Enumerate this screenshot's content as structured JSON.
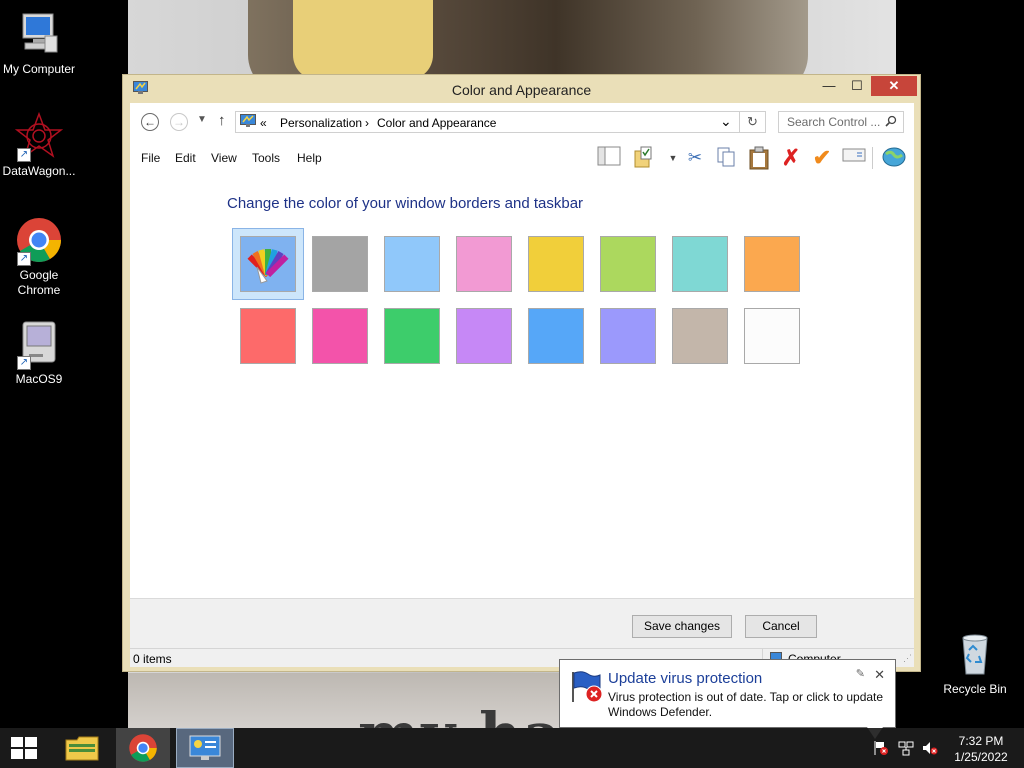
{
  "desktop": {
    "icons": [
      {
        "label": "My Computer",
        "icon": "computer-icon"
      },
      {
        "label": "DataWagon...",
        "icon": "datawagon-icon"
      },
      {
        "label": "Google Chrome",
        "icon": "chrome-icon"
      },
      {
        "label": "MacOS9",
        "icon": "macos9-icon"
      },
      {
        "label": "Recycle Bin",
        "icon": "recycle-bin-icon"
      }
    ],
    "wallpaper_text": "my hals"
  },
  "window": {
    "title": "Color and Appearance",
    "controls": {
      "minimize": "—",
      "maximize": "☐",
      "close": "✕"
    },
    "address": {
      "overflow": "«",
      "crumbs": [
        "Personalization",
        "Color and Appearance"
      ],
      "separator": "›",
      "dropdown": "⌄",
      "refresh": "↻"
    },
    "search": {
      "placeholder": "Search Control ..."
    },
    "menu": [
      "File",
      "Edit",
      "View",
      "Tools",
      "Help"
    ],
    "toolbar_icons": [
      "pane-icon",
      "properties-icon",
      "cut-icon",
      "copy-icon",
      "paste-icon",
      "delete-icon",
      "check-icon",
      "rename-icon",
      "globe-icon"
    ],
    "heading": "Change the color of your window borders and taskbar",
    "colors": [
      {
        "color": "#7fb2f0",
        "selected": true,
        "automatic": true
      },
      {
        "color": "#a4a4a4"
      },
      {
        "color": "#90c8fa"
      },
      {
        "color": "#f29ad3"
      },
      {
        "color": "#f1cf3a"
      },
      {
        "color": "#acd85e"
      },
      {
        "color": "#7fd8d4"
      },
      {
        "color": "#fba84f"
      },
      {
        "color": "#fd6a6a"
      },
      {
        "color": "#f353aa"
      },
      {
        "color": "#3dcd6b"
      },
      {
        "color": "#c688f6"
      },
      {
        "color": "#56a7f8"
      },
      {
        "color": "#9b99fc"
      },
      {
        "color": "#c3b6aa"
      },
      {
        "color": "#fcfcfc"
      }
    ],
    "buttons": {
      "save": "Save changes",
      "cancel": "Cancel"
    },
    "status": {
      "items": "0 items",
      "location": "Computer"
    }
  },
  "notification": {
    "title": "Update virus protection",
    "body": "Virus protection is out of date. Tap or click to update Windows Defender."
  },
  "taskbar": {
    "clock_time": "7:32 PM",
    "clock_date": "1/25/2022"
  }
}
